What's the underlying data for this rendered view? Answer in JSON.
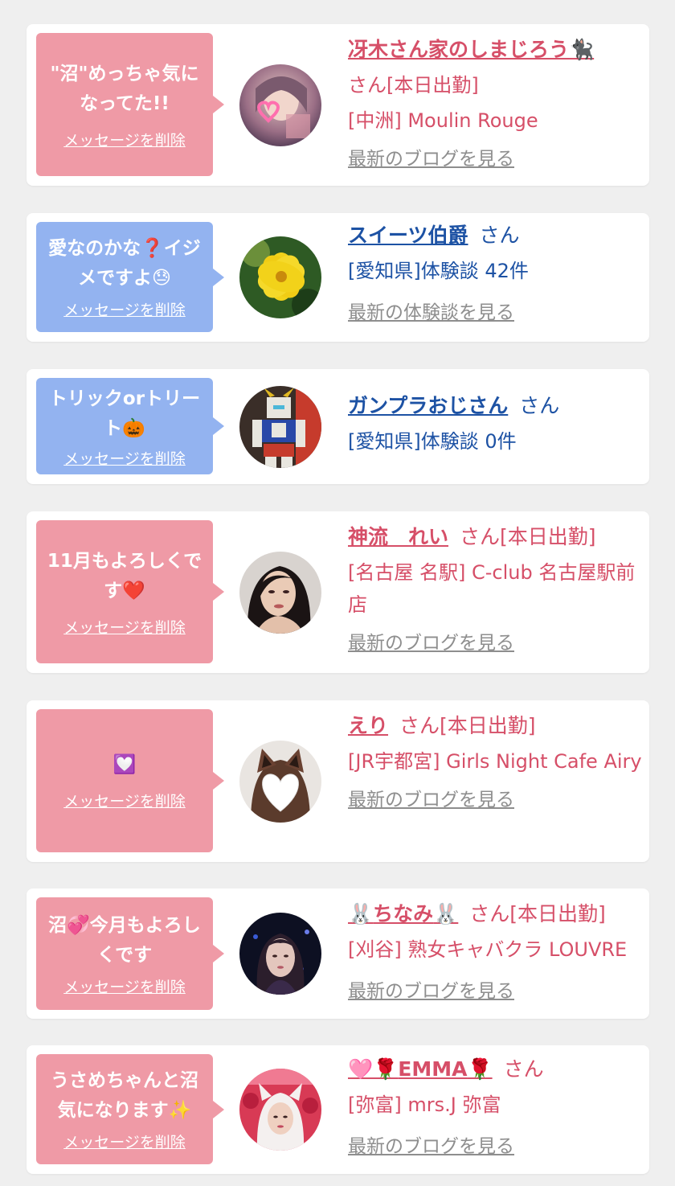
{
  "cards": [
    {
      "message": "\"沼\"めっちゃ気に\nなってた!!",
      "delete_label": "メッセージを削除",
      "name": "冴木さん家のしまじろう",
      "name_suffix_emoji": "🐈‍⬛",
      "san": "さん[本日出勤]",
      "detail": "[中洲] Moulin Rouge",
      "link": "最新のブログを見る",
      "avatar_icon": "avatar-photo-woman-heart"
    },
    {
      "message": "愛なのかな❓イジ\nメですよ😓",
      "delete_label": "メッセージを削除",
      "name": "スイーツ伯爵",
      "san": "さん",
      "detail": "[愛知県]体験談 42件",
      "link": "最新の体験談を見る",
      "avatar_icon": "avatar-yellow-flower"
    },
    {
      "message": "トリックorトリー\nト🎃",
      "delete_label": "メッセージを削除",
      "name": "ガンプラおじさん",
      "san": "さん",
      "detail": "[愛知県]体験談 0件",
      "avatar_icon": "avatar-gundam-model"
    },
    {
      "message": "11月もよろしくで\nす❤️",
      "delete_label": "メッセージを削除",
      "name": "神流　れい",
      "san": "さん[本日出勤]",
      "detail": "[名古屋 名駅] C-club 名古屋駅前店",
      "link": "最新のブログを見る",
      "avatar_icon": "avatar-photo-woman"
    },
    {
      "message": "💟",
      "delete_label": "メッセージを削除",
      "name": "えり",
      "san": "さん[本日出勤]",
      "detail": "[JR宇都宮] Girls Night Cafe Airy",
      "link": "最新のブログを見る",
      "avatar_icon": "avatar-cat-ears-heart"
    },
    {
      "message": "沼💞今月もよろし\nくです",
      "delete_label": "メッセージを削除",
      "name_prefix_emoji": "🐰",
      "name": "ちなみ",
      "name_suffix_emoji": "🐰",
      "san": "さん[本日出勤]",
      "detail": "[刈谷] 熟女キャバクラ LOUVRE",
      "link": "最新のブログを見る",
      "avatar_icon": "avatar-dark-portrait"
    },
    {
      "message": "うさめちゃんと沼\n気になります✨",
      "delete_label": "メッセージを削除",
      "name_prefix_emoji": "🩷🌹",
      "name": "EMMA",
      "name_suffix_emoji": "🌹",
      "san": "さん",
      "detail": "[弥富] mrs.J 弥富",
      "link": "最新のブログを見る",
      "avatar_icon": "avatar-red-costume"
    }
  ],
  "colors": {
    "pink_bubble": "#ef9aa6",
    "blue_bubble": "#93b3f0",
    "cast_text": "#d64f68",
    "user_text": "#1d52a4",
    "link_gray": "#8e8e8e"
  }
}
